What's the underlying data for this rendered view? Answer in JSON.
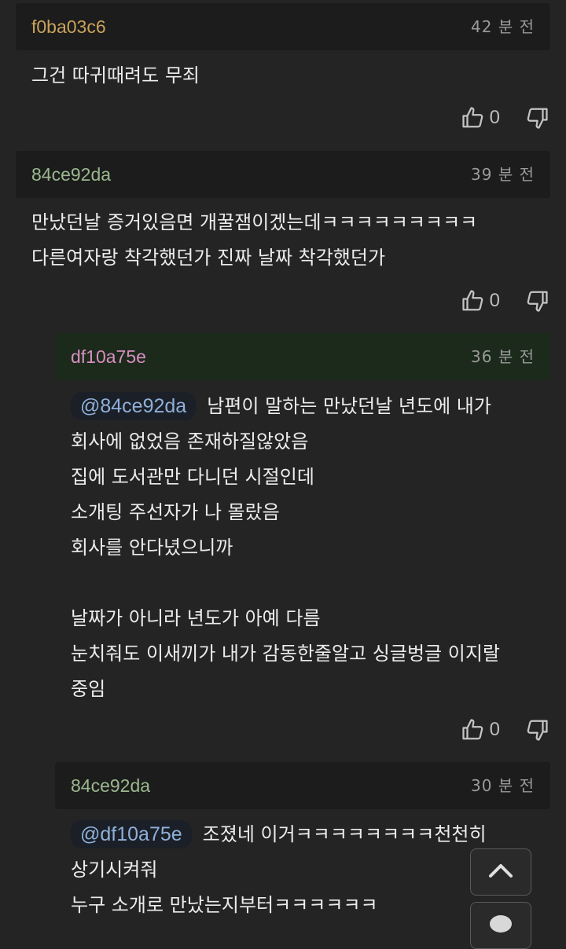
{
  "comments": [
    {
      "author": "f0ba03c6",
      "author_color": "#c9a35a",
      "time": "42 분 전",
      "text": "그건 따귀때려도 무죄",
      "likes": "0"
    },
    {
      "author": "84ce92da",
      "author_color": "#9ab88e",
      "time": "39 분 전",
      "text": "만났던날 증거있음면 개꿀잼이겠는데ㅋㅋㅋㅋㅋㅋㅋㅋㅋ\n다른여자랑 착각했던가 진짜 날짜 착각했던가",
      "likes": "0"
    },
    {
      "author": "df10a75e",
      "author_color": "#d98fc0",
      "time": "36 분 전",
      "mention": "@84ce92da",
      "text": "남편이 말하는 만났던날 년도에 내가\n회사에 없었음 존재하질않았음\n집에 도서관만 다니던 시절인데\n소개팅 주선자가 나 몰랐음\n회사를 안다녔으니까\n\n날짜가 아니라 년도가 아예 다름\n눈치줘도 이새끼가 내가 감동한줄알고 싱글벙글 이지랄\n중임",
      "likes": "0"
    },
    {
      "author": "84ce92da",
      "author_color": "#9ab88e",
      "time": "30 분 전",
      "mention": "@df10a75e",
      "text": "조졌네 이거ㅋㅋㅋㅋㅋㅋㅋㅋ천천히\n상기시켜줘\n누구 소개로 만났는지부터ㅋㅋㅋㅋㅋㅋ"
    }
  ],
  "icons": {
    "like": "thumbs-up-icon",
    "dislike": "thumbs-down-icon",
    "scroll_top": "chevron-up-icon",
    "comment": "comment-bubble-icon"
  },
  "colors": {
    "background": "#242424",
    "header": "#1c1c1c",
    "highlight_header": "#1b2a1b",
    "time": "#9a9a9a",
    "mention_text": "#8fb0d8"
  }
}
